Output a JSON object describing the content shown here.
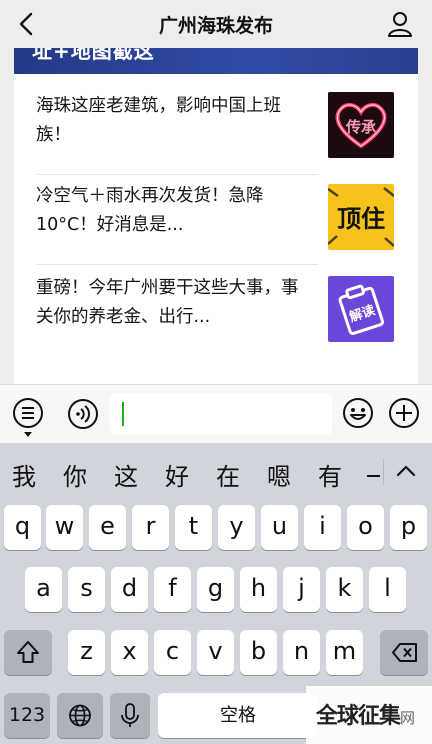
{
  "nav": {
    "title": "广州海珠发布",
    "back_icon": "chevron-left-icon",
    "profile_icon": "person-icon"
  },
  "card": {
    "banner_text": "址+地图截这",
    "articles": [
      {
        "title": "海珠这座老建筑，影响中国上班族！",
        "thumb_icon": "heart-neon-icon",
        "thumb_text": "传承"
      },
      {
        "title": "冷空气＋雨水再次发货！急降10°C！好消息是...",
        "thumb_icon": "top-sticker-icon",
        "thumb_text": "顶住"
      },
      {
        "title": "重磅！今年广州要干这些大事，事关你的养老金、出行...",
        "thumb_icon": "clipboard-icon",
        "thumb_text": "解读"
      }
    ]
  },
  "input_bar": {
    "menu_icon": "menu-list-icon",
    "voice_icon": "voice-icon",
    "emoji_icon": "emoji-icon",
    "plus_icon": "plus-icon",
    "value": ""
  },
  "keyboard": {
    "candidates": [
      "我",
      "你",
      "这",
      "好",
      "在",
      "嗯",
      "有",
      "一"
    ],
    "row1": [
      "q",
      "w",
      "e",
      "r",
      "t",
      "y",
      "u",
      "i",
      "o",
      "p"
    ],
    "row2": [
      "a",
      "s",
      "d",
      "f",
      "g",
      "h",
      "j",
      "k",
      "l"
    ],
    "row3": [
      "z",
      "x",
      "c",
      "v",
      "b",
      "n",
      "m"
    ],
    "numbers_label": "123",
    "space_label": "空格",
    "shift_icon": "shift-icon",
    "delete_icon": "backspace-icon",
    "globe_icon": "globe-icon",
    "mic_icon": "microphone-icon",
    "expand_icon": "chevron-up-icon"
  },
  "watermark": {
    "text": "全球征集",
    "suffix": "网"
  },
  "colors": {
    "accent_green": "#1aad19",
    "banner_blue": "#2f4ba5",
    "keyboard_bg": "#d1d4da"
  }
}
